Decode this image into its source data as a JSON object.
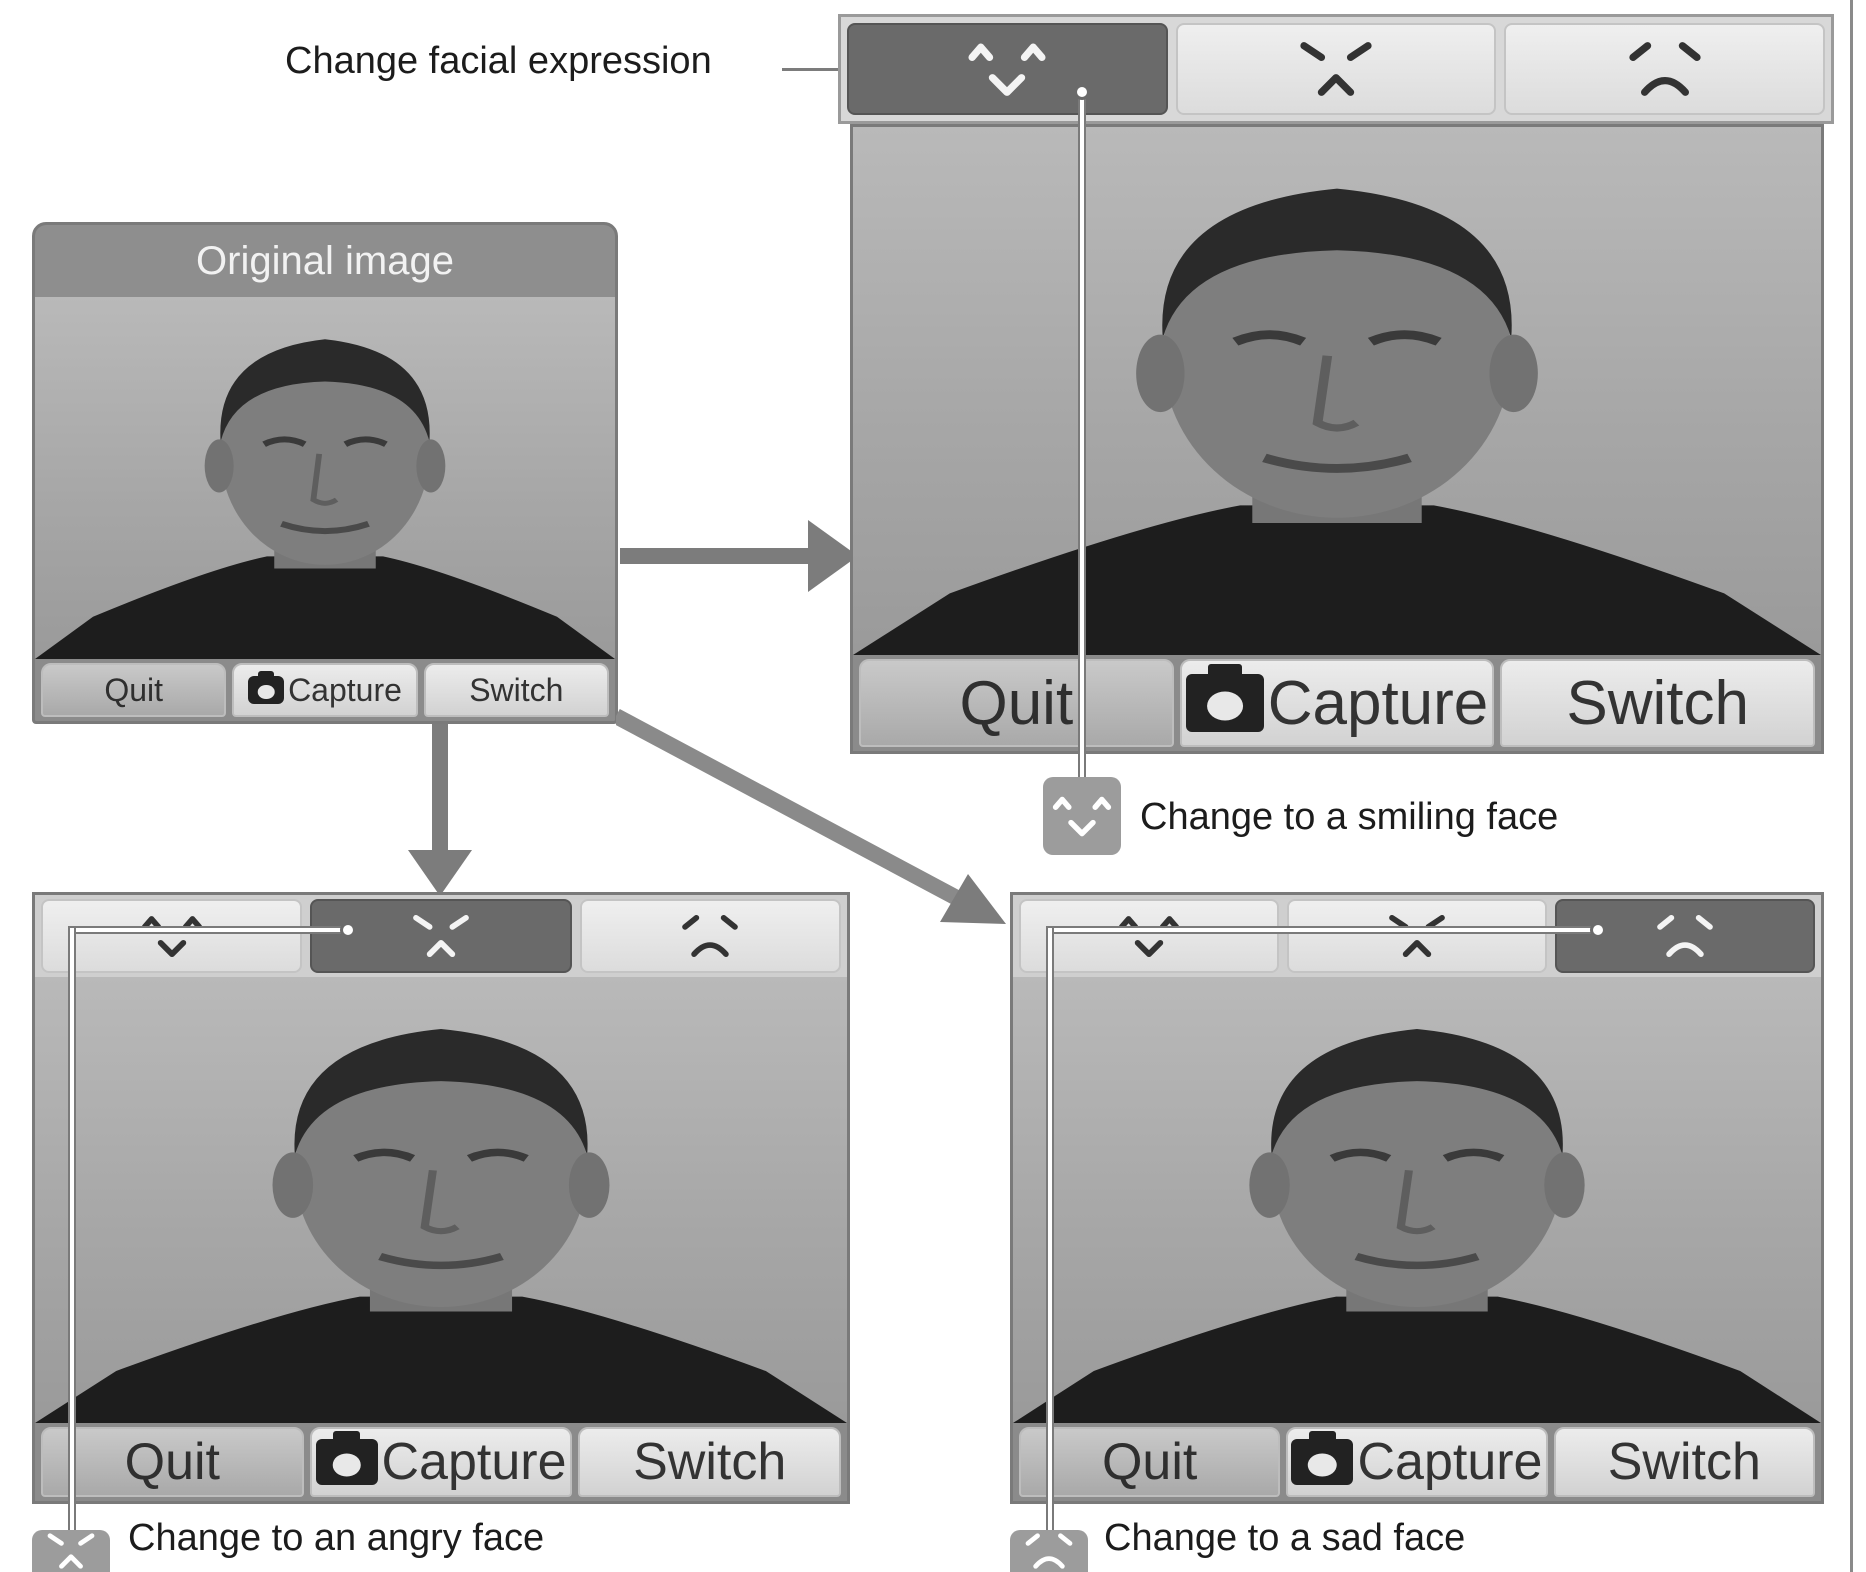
{
  "labels": {
    "change_expression": "Change facial expression",
    "original_image": "Original image",
    "smiling": "Change to a smiling face",
    "angry": "Change to an angry face",
    "sad": "Change to a sad face"
  },
  "buttons": {
    "quit": "Quit",
    "capture": "Capture",
    "switch": "Switch"
  },
  "icons": {
    "smile": "smile-face-icon",
    "angry": "angry-face-icon",
    "sad": "sad-face-icon",
    "camera": "camera-icon"
  }
}
